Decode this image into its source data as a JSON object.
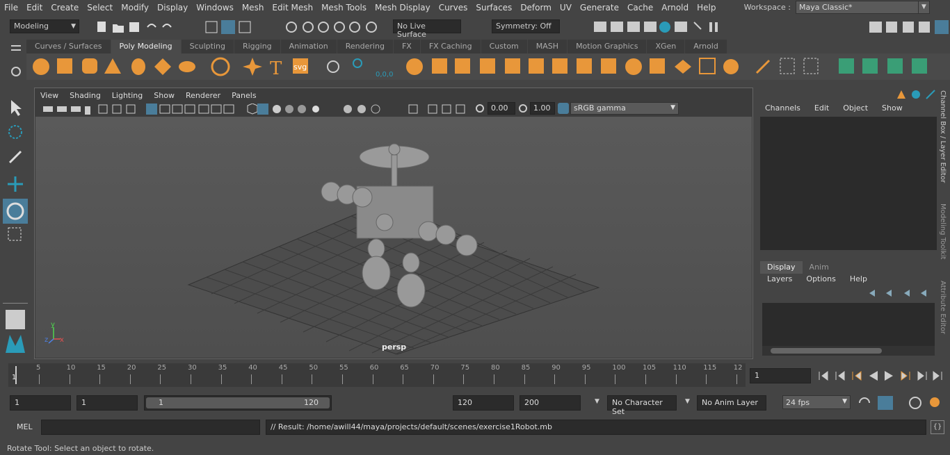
{
  "menubar": {
    "items": [
      "File",
      "Edit",
      "Create",
      "Select",
      "Modify",
      "Display",
      "Windows",
      "Mesh",
      "Edit Mesh",
      "Mesh Tools",
      "Mesh Display",
      "Curves",
      "Surfaces",
      "Deform",
      "UV",
      "Generate",
      "Cache",
      "Arnold",
      "Help"
    ],
    "workspace_label": "Workspace :",
    "workspace_value": "Maya Classic*"
  },
  "statusline": {
    "menuset": "Modeling",
    "live_surface": "No Live Surface",
    "symmetry": "Symmetry: Off"
  },
  "shelf": {
    "tabs": [
      "Curves / Surfaces",
      "Poly Modeling",
      "Sculpting",
      "Rigging",
      "Animation",
      "Rendering",
      "FX",
      "FX Caching",
      "Custom",
      "MASH",
      "Motion Graphics",
      "XGen",
      "Arnold"
    ],
    "active_tab": "Poly Modeling",
    "svg_label": "svg",
    "coords_label": "0,0,0"
  },
  "viewport": {
    "menus": [
      "View",
      "Shading",
      "Lighting",
      "Show",
      "Renderer",
      "Panels"
    ],
    "exposure": "0.00",
    "gamma": "1.00",
    "colorspace": "sRGB gamma",
    "camera_label": "persp",
    "axis_y": "y",
    "axis_x": "x",
    "axis_z": "z"
  },
  "channelbox": {
    "menus": [
      "Channels",
      "Edit",
      "Object",
      "Show"
    ],
    "tabs": [
      "Display",
      "Anim"
    ],
    "active_tab": "Display",
    "layer_menus": [
      "Layers",
      "Options",
      "Help"
    ]
  },
  "side_tabs": [
    "Channel Box / Layer Editor",
    "Modeling Toolkit",
    "Attribute Editor"
  ],
  "timeline": {
    "ticks": [
      "5",
      "10",
      "15",
      "20",
      "25",
      "30",
      "35",
      "40",
      "45",
      "50",
      "55",
      "60",
      "65",
      "70",
      "75",
      "80",
      "85",
      "90",
      "95",
      "100",
      "105",
      "110",
      "115",
      "12"
    ],
    "start_frame_label": "1",
    "current_frame": "1"
  },
  "range": {
    "start": "1",
    "playback_start": "1",
    "slider_start": "1",
    "slider_end": "120",
    "playback_end": "120",
    "end": "200",
    "character_set": "No Character Set",
    "anim_layer": "No Anim Layer",
    "fps": "24 fps"
  },
  "command": {
    "lang": "MEL",
    "result": "// Result: /home/awill44/maya/projects/default/scenes/exercise1Robot.mb"
  },
  "help_line": "Rotate Tool: Select an object to rotate."
}
